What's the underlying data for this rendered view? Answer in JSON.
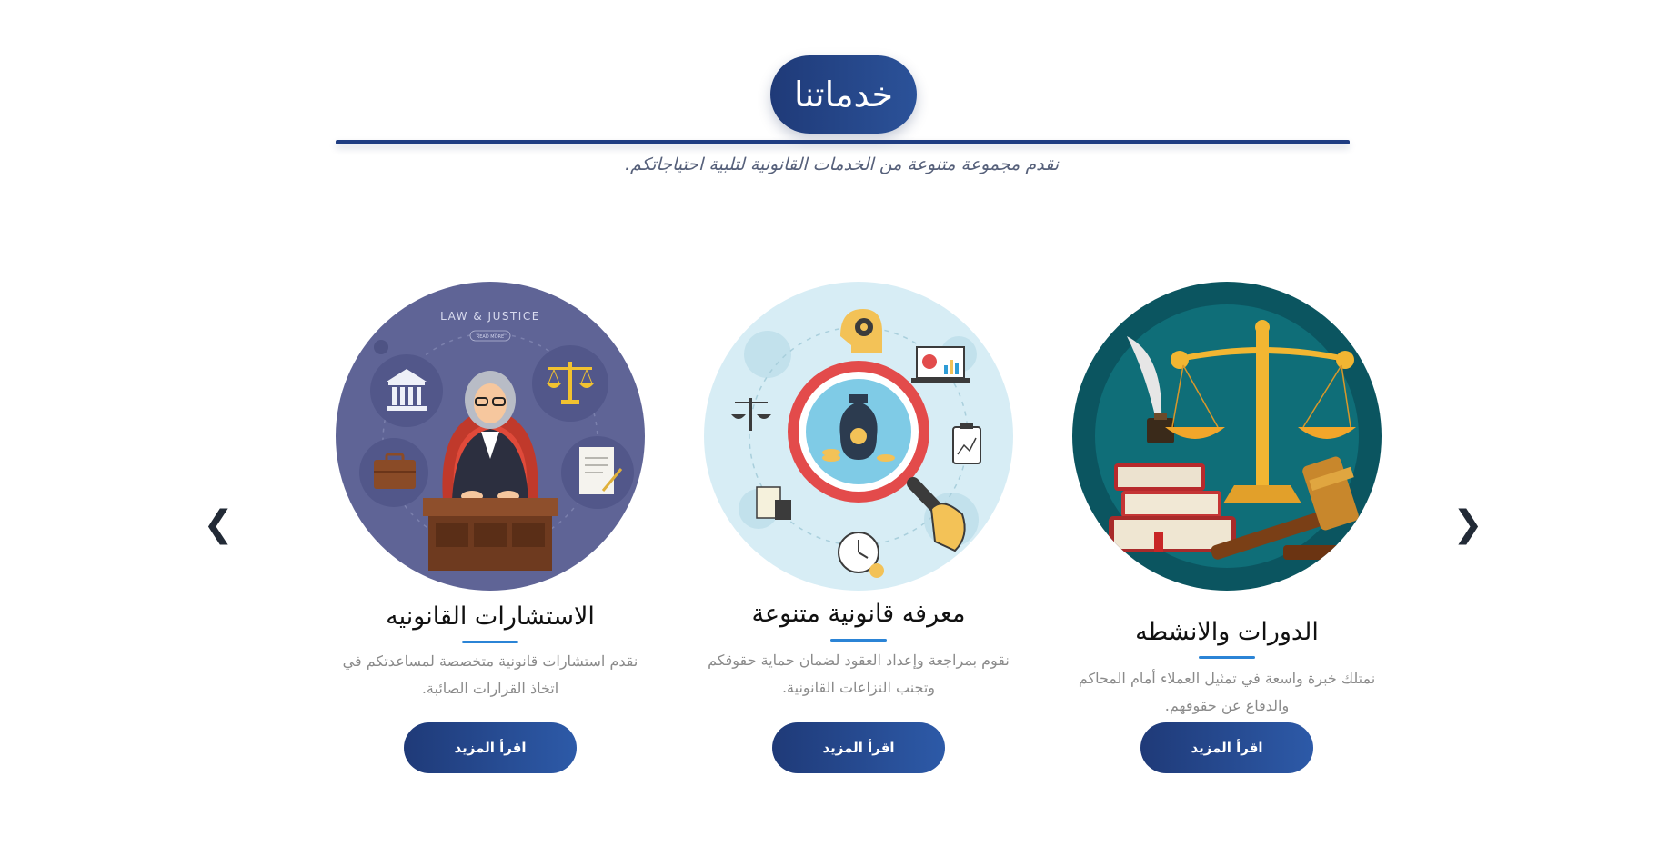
{
  "section": {
    "title": "خدماتنا",
    "subtitle": "نقدم مجموعة متنوعة من الخدمات القانونية لتلبية احتياجاتكم."
  },
  "carousel": {
    "prev_arrow": "❮",
    "next_arrow": "❯",
    "cards": [
      {
        "title": "الاستشارات القانونيه",
        "description": "نقدم استشارات قانونية متخصصة لمساعدتكم في اتخاذ القرارات الصائبة.",
        "button_label": "اقرأ المزيد",
        "image_icon": "judge-law-justice-illustration",
        "image_text": "LAW & JUSTICE",
        "image_subtext": "READ MORE"
      },
      {
        "title": "معرفه قانونية متنوعة",
        "description": "نقوم بمراجعة وإعداد العقود لضمان حماية حقوقكم وتجنب النزاعات القانونية.",
        "button_label": "اقرأ المزيد",
        "image_icon": "magnifier-legal-knowledge-illustration"
      },
      {
        "title": "الدورات والانشطه",
        "description": "نمتلك خبرة واسعة في تمثيل العملاء أمام المحاكم والدفاع عن حقوقهم.",
        "button_label": "اقرأ المزيد",
        "image_icon": "scales-gavel-books-illustration"
      }
    ]
  },
  "colors": {
    "primary_dark": "#1f3a78",
    "primary_light": "#2d5aa8",
    "accent_underline": "#2b84d6",
    "description_gray": "#8a8a8a",
    "subtitle_gray": "#56607a"
  }
}
